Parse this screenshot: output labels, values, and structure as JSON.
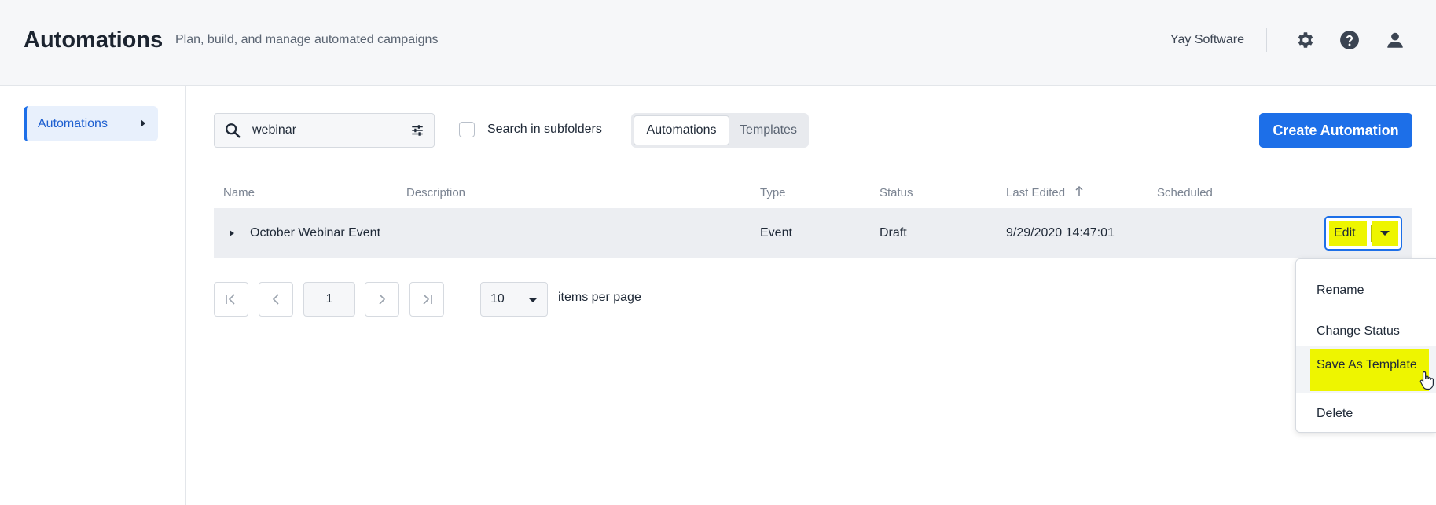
{
  "header": {
    "title": "Automations",
    "subtitle": "Plan, build, and manage automated campaigns",
    "account": "Yay Software",
    "icons": [
      "gear-icon",
      "help-icon",
      "user-icon"
    ]
  },
  "sidebar": {
    "items": [
      {
        "label": "Automations"
      }
    ]
  },
  "toolbar": {
    "search_value": "webinar",
    "search_in_subfolders_label": "Search in subfolders",
    "search_in_subfolders_checked": false,
    "tabs": [
      {
        "label": "Automations",
        "active": true
      },
      {
        "label": "Templates",
        "active": false
      }
    ],
    "create_label": "Create Automation"
  },
  "table": {
    "columns": [
      "Name",
      "Description",
      "Type",
      "Status",
      "Last Edited",
      "Scheduled"
    ],
    "sort_column": "Last Edited",
    "rows": [
      {
        "name": "October Webinar Event",
        "description": "",
        "type": "Event",
        "status": "Draft",
        "last_edited": "9/29/2020 14:47:01",
        "scheduled": ""
      }
    ],
    "edit_label": "Edit"
  },
  "pagination": {
    "current_page": "1",
    "per_page": "10",
    "per_page_label": "items per page"
  },
  "menu": {
    "items": [
      "Rename",
      "Change Status",
      "Save As Template",
      "Delete"
    ]
  },
  "colors": {
    "accent": "#1d6fe8",
    "highlight": "#eef500",
    "header_bg": "#f6f7f9"
  }
}
